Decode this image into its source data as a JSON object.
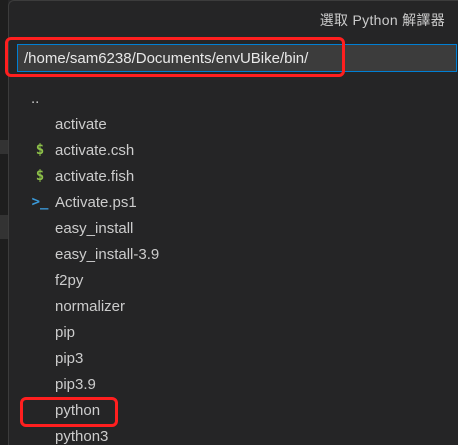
{
  "dialog": {
    "title": "選取 Python 解譯器"
  },
  "path_input": {
    "value": "/home/sam6238/Documents/envUBike/bin/"
  },
  "files": [
    {
      "name": "..",
      "icon": "parent-dir"
    },
    {
      "name": "activate",
      "icon": "file-lines-icon"
    },
    {
      "name": "activate.csh",
      "icon": "shell-dollar-icon"
    },
    {
      "name": "activate.fish",
      "icon": "shell-dollar-icon"
    },
    {
      "name": "Activate.ps1",
      "icon": "powershell-icon"
    },
    {
      "name": "easy_install",
      "icon": "file-lines-icon"
    },
    {
      "name": "easy_install-3.9",
      "icon": "file-lines-icon"
    },
    {
      "name": "f2py",
      "icon": "file-lines-icon"
    },
    {
      "name": "normalizer",
      "icon": "file-lines-icon"
    },
    {
      "name": "pip",
      "icon": "file-lines-icon"
    },
    {
      "name": "pip3",
      "icon": "file-lines-icon"
    },
    {
      "name": "pip3.9",
      "icon": "file-lines-icon"
    },
    {
      "name": "python",
      "icon": "file-lines-icon"
    },
    {
      "name": "python3",
      "icon": "file-lines-icon"
    }
  ],
  "colors": {
    "highlight": "#ff1f1f",
    "focus_border": "#007fd4",
    "shell_icon": "#8dc149",
    "powershell_icon": "#3b9ad9"
  }
}
